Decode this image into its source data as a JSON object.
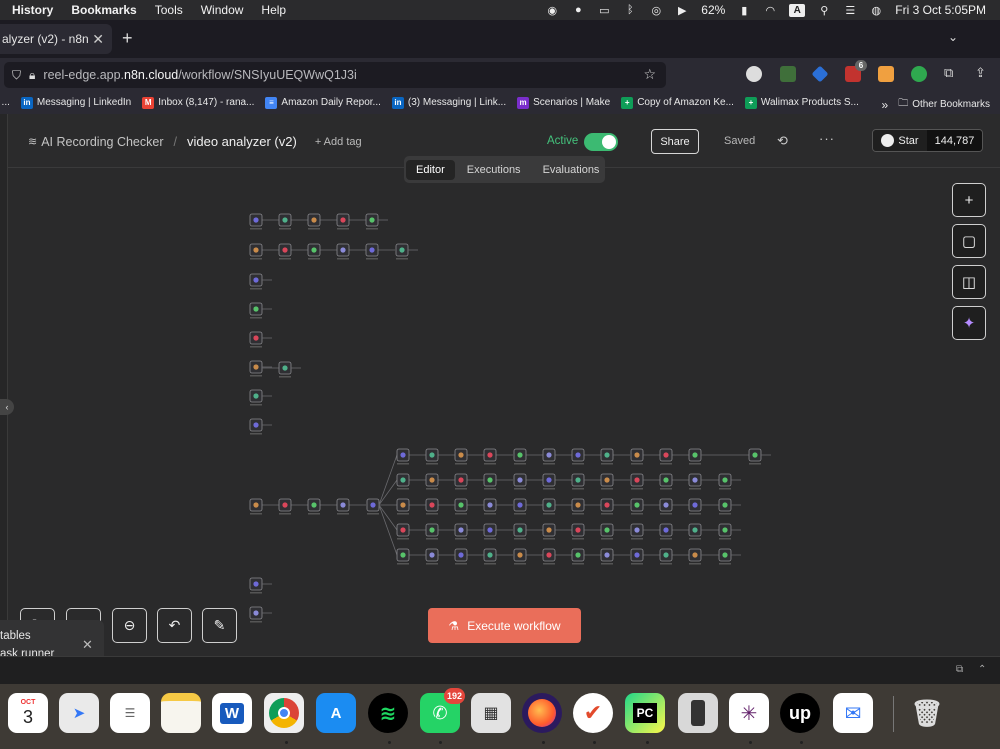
{
  "menubar": {
    "items": [
      "History",
      "Bookmarks",
      "Tools",
      "Window",
      "Help"
    ],
    "battery": "62%",
    "input_source": "A",
    "datetime": "Fri 3 Oct  5:05PM"
  },
  "browser": {
    "tab_title": "alyzer (v2) - n8n",
    "url_prefix": "reel-edge.app.",
    "url_domain": "n8n.cloud",
    "url_path": "/workflow/SNSIyuUEQWwQ1J3i",
    "extension_badge": "6",
    "bookmarks": [
      {
        "label": "t ...",
        "icon": "bookmark-icon",
        "color": "#555"
      },
      {
        "label": "Messaging | LinkedIn",
        "icon": "linkedin-icon",
        "color": "#0a66c2",
        "glyph": "in"
      },
      {
        "label": "Inbox (8,147) - rana...",
        "icon": "gmail-icon",
        "color": "#ea4335",
        "glyph": "M"
      },
      {
        "label": "Amazon Daily Repor...",
        "icon": "docs-icon",
        "color": "#4285f4",
        "glyph": "≡"
      },
      {
        "label": "(3) Messaging | Link...",
        "icon": "linkedin-icon",
        "color": "#0a66c2",
        "glyph": "in"
      },
      {
        "label": "Scenarios | Make",
        "icon": "make-icon",
        "color": "#7a2ecc",
        "glyph": "m"
      },
      {
        "label": "Copy of Amazon Ke...",
        "icon": "sheets-icon",
        "color": "#0f9d58",
        "glyph": "+"
      },
      {
        "label": "Walimax Products S...",
        "icon": "sheets-icon",
        "color": "#0f9d58",
        "glyph": "+"
      }
    ],
    "other_bookmarks": "Other Bookmarks"
  },
  "app": {
    "project": "AI Recording Checker",
    "workflow_name": "video analyzer (v2)",
    "add_tag": "+ Add tag",
    "active_label": "Active",
    "share_label": "Share",
    "saved_label": "Saved",
    "star_label": "Star",
    "star_count": "144,787",
    "tabs": [
      "Editor",
      "Executions",
      "Evaluations"
    ],
    "active_tab": "Editor",
    "execute_label": "Execute workflow",
    "toast_line1": "tables",
    "toast_line2": "ask runner",
    "accent": "#ea6e5a",
    "active_color": "#3cba72"
  },
  "dock": {
    "calendar_month": "OCT",
    "calendar_day": "3",
    "whatsapp_badge": "192",
    "pycharm_label": "PC",
    "upwork_label": "up",
    "word_label": "W"
  }
}
